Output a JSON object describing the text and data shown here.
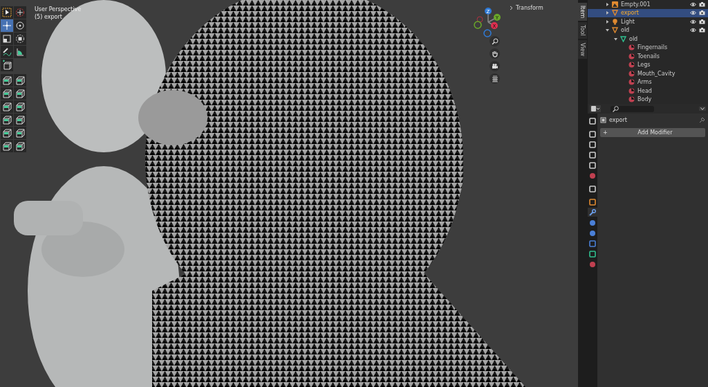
{
  "viewport": {
    "view_name": "User Perspective",
    "object_info": "(5) export",
    "toolbar": [
      {
        "kind": "select",
        "selected": false
      },
      {
        "kind": "cursor",
        "selected": false
      },
      {
        "kind": "move",
        "selected": true
      },
      {
        "kind": "rotate",
        "selected": false
      },
      {
        "kind": "scale",
        "selected": false
      },
      {
        "kind": "transform",
        "selected": false
      },
      {
        "kind": "annotate",
        "selected": false
      },
      {
        "kind": "measure",
        "selected": false
      },
      {
        "kind": "add-cube",
        "selected": false
      },
      {
        "kind": "extrude",
        "selected": false
      },
      {
        "kind": "inset",
        "selected": false
      },
      {
        "kind": "bevel",
        "selected": false
      },
      {
        "kind": "loop-cut",
        "selected": false
      },
      {
        "kind": "knife",
        "selected": false
      },
      {
        "kind": "poly-build",
        "selected": false
      },
      {
        "kind": "spin",
        "selected": false
      },
      {
        "kind": "smooth",
        "selected": false
      },
      {
        "kind": "edge-slide",
        "selected": false
      },
      {
        "kind": "shrink",
        "selected": false
      },
      {
        "kind": "shear",
        "selected": false
      },
      {
        "kind": "rip",
        "selected": false
      }
    ],
    "gizmo": {
      "z": "Z",
      "y": "Y",
      "x": "X"
    },
    "panel_header": "Transform"
  },
  "sidebar_tabs": [
    {
      "label": "Item",
      "selected": true
    },
    {
      "label": "Tool",
      "selected": false
    },
    {
      "label": "View",
      "selected": false
    }
  ],
  "outliner": {
    "items": [
      {
        "label": "Empty.001",
        "kind": "empty",
        "selected": false,
        "expanded": false,
        "visible": true
      },
      {
        "label": "export",
        "kind": "object",
        "selected": true,
        "expanded": false,
        "visible": true
      },
      {
        "label": "Light",
        "kind": "light",
        "selected": false,
        "expanded": false,
        "visible": true
      },
      {
        "label": "old",
        "kind": "object",
        "selected": false,
        "expanded": true,
        "visible": true,
        "children": [
          {
            "label": "old",
            "kind": "mesh",
            "selected": false,
            "expanded": true,
            "children": [
              {
                "label": "Fingernails",
                "kind": "material",
                "selected": false
              },
              {
                "label": "Toenails",
                "kind": "material",
                "selected": false
              },
              {
                "label": "Legs",
                "kind": "material",
                "selected": false
              },
              {
                "label": "Mouth_Cavity",
                "kind": "material",
                "selected": false
              },
              {
                "label": "Arms",
                "kind": "material",
                "selected": false
              },
              {
                "label": "Head",
                "kind": "material",
                "selected": false
              },
              {
                "label": "Body",
                "kind": "material",
                "selected": false
              }
            ]
          }
        ]
      }
    ]
  },
  "properties": {
    "object_name": "export",
    "add_button": "Add Modifier",
    "add_symbol": "+",
    "tabs": [
      {
        "kind": "tool",
        "selected": false
      },
      {
        "kind": "render",
        "selected": false
      },
      {
        "kind": "output",
        "selected": false
      },
      {
        "kind": "view-layer",
        "selected": false
      },
      {
        "kind": "scene",
        "selected": false
      },
      {
        "kind": "world",
        "selected": false
      },
      {
        "kind": "collection",
        "selected": false
      },
      {
        "kind": "object",
        "selected": false
      },
      {
        "kind": "modifier",
        "selected": true
      },
      {
        "kind": "particles",
        "selected": false
      },
      {
        "kind": "physics",
        "selected": false
      },
      {
        "kind": "constraints",
        "selected": false
      },
      {
        "kind": "data",
        "selected": false
      },
      {
        "kind": "material",
        "selected": false
      }
    ]
  }
}
